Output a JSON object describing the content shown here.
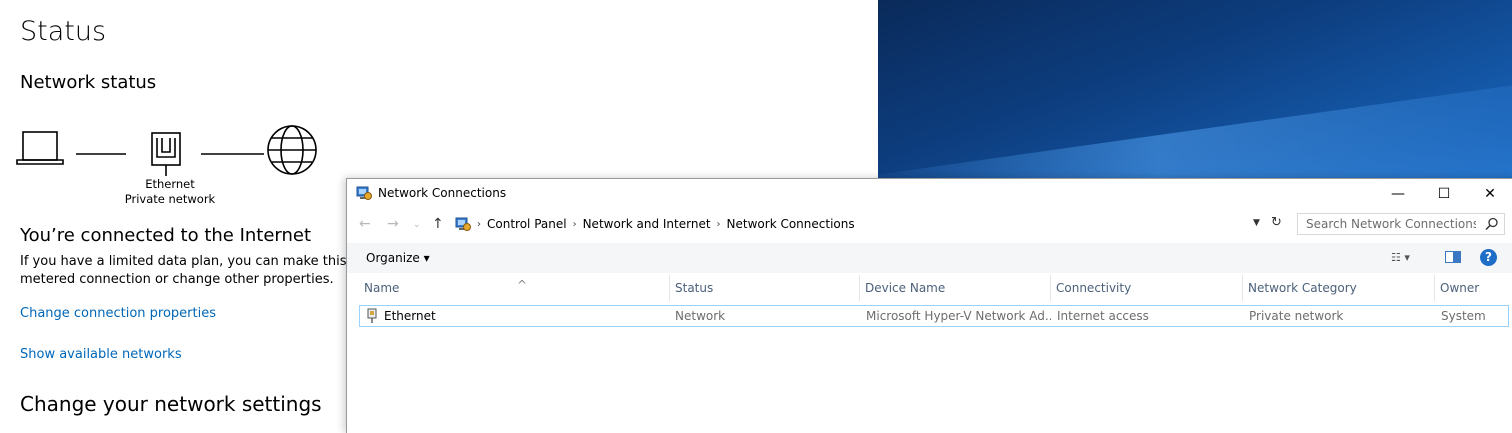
{
  "settings": {
    "title": "Status",
    "network_status_heading": "Network status",
    "adapter_label": "Ethernet",
    "network_profile": "Private network",
    "connected_heading": "You’re connected to the Internet",
    "description_line1": "If you have a limited data plan, you can make this network a",
    "description_line2": "metered connection or change other properties.",
    "change_connection_link": "Change connection properties",
    "show_networks_link": "Show available networks",
    "change_settings_heading": "Change your network settings"
  },
  "window": {
    "title": "Network Connections",
    "minimize_glyph": "—",
    "maximize_glyph": "☐",
    "close_glyph": "✕",
    "breadcrumb": [
      "Control Panel",
      "Network and Internet",
      "Network Connections"
    ],
    "search_placeholder": "Search Network Connections",
    "organize_label": "Organize ▾",
    "columns": [
      "Name",
      "Status",
      "Device Name",
      "Connectivity",
      "Network Category",
      "Owner"
    ],
    "rows": [
      {
        "name": "Ethernet",
        "status": "Network",
        "device_name": "Microsoft Hyper-V Network Ad...",
        "connectivity": "Internet access",
        "category": "Private network",
        "owner": "System"
      }
    ]
  },
  "colors": {
    "link": "#0067b8",
    "selection_border": "#99d1ff",
    "header_text": "#4c607a"
  },
  "icons": [
    "laptop-icon",
    "ethernet-icon",
    "globe-icon",
    "network-connections-icon",
    "search-icon",
    "help-icon",
    "preview-pane-icon",
    "view-options-icon",
    "refresh-icon"
  ]
}
